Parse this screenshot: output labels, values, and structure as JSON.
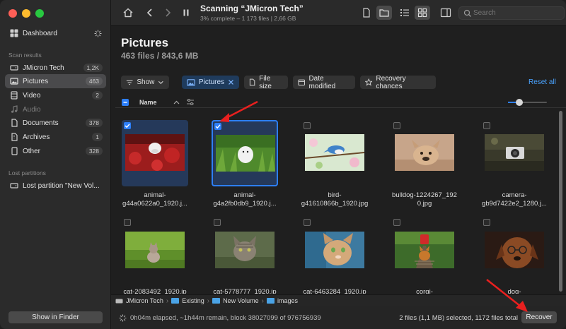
{
  "app": {
    "scan_title": "Scanning “JMicron Tech”",
    "scan_subtitle": "3% complete – 1 173 files | 2,66 GB",
    "search_placeholder": "Search"
  },
  "sidebar": {
    "dashboard": "Dashboard",
    "scan_results_title": "Scan results",
    "items": [
      {
        "label": "JMicron Tech",
        "badge": "1,2K",
        "icon": "disk-icon"
      },
      {
        "label": "Pictures",
        "badge": "463",
        "icon": "picture-icon"
      },
      {
        "label": "Video",
        "badge": "2",
        "icon": "film-icon"
      },
      {
        "label": "Audio",
        "badge": "",
        "icon": "music-note-icon"
      },
      {
        "label": "Documents",
        "badge": "378",
        "icon": "document-icon"
      },
      {
        "label": "Archives",
        "badge": "1",
        "icon": "archive-icon"
      },
      {
        "label": "Other",
        "badge": "328",
        "icon": "other-file-icon"
      }
    ],
    "lost_partitions_title": "Lost partitions",
    "lost_partition": "Lost partition \"New Vol...",
    "show_in_finder": "Show in Finder"
  },
  "header": {
    "title": "Pictures",
    "subtitle": "463 files / 843,6 MB"
  },
  "filters": {
    "show": "Show",
    "pictures": "Pictures",
    "file_size": "File size",
    "date_modified": "Date modified",
    "recovery_chances": "Recovery chances",
    "reset_all": "Reset all"
  },
  "column": {
    "name": "Name"
  },
  "files": [
    {
      "name": "animal-\ng44a0622a0_1920.j...",
      "checked": true
    },
    {
      "name": "animal-\ng4a2fb0db9_1920.j...",
      "checked": true
    },
    {
      "name": "bird-\ng41610866b_1920.jpg",
      "checked": false
    },
    {
      "name": "bulldog-1224267_192\n0.jpg",
      "checked": false
    },
    {
      "name": "camera-\ngb9d7422e2_1280.j...",
      "checked": false
    },
    {
      "name": "cat-2083492_1920.jp",
      "checked": false
    },
    {
      "name": "cat-5778777_1920.jp",
      "checked": false
    },
    {
      "name": "cat-6463284_1920.jp",
      "checked": false
    },
    {
      "name": "corgi-",
      "checked": false
    },
    {
      "name": "dog-",
      "checked": false
    }
  ],
  "path": [
    "JMicron Tech",
    "Existing",
    "New Volume",
    "images"
  ],
  "status": {
    "left": "0h04m elapsed, ~1h44m remain, block 38027099 of 976756939",
    "right": "2 files (1,1 MB) selected, 1172 files total",
    "recover": "Recover"
  },
  "colors": {
    "accent": "#2d7ff9",
    "annotation_arrow": "#e8201f"
  }
}
